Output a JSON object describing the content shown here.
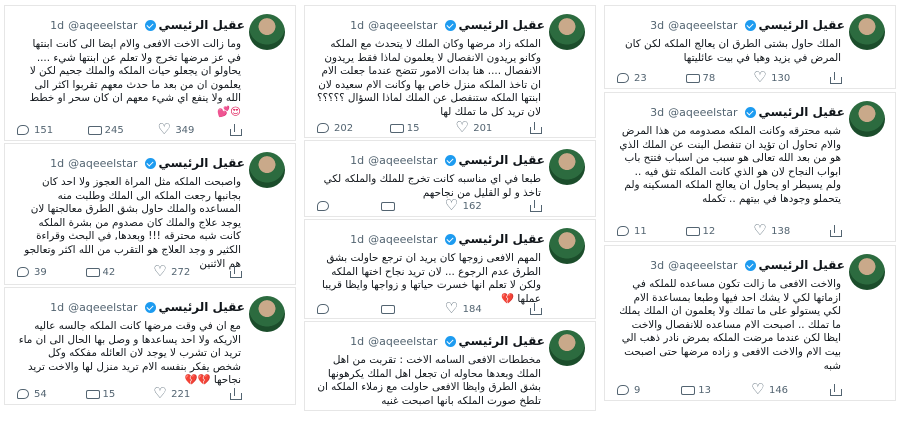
{
  "user": {
    "name": "عقيل الرئيسي",
    "handle": "@aqeeelstar"
  },
  "tweets": [
    {
      "time": "1d",
      "text": "وما زالت الاخت الافعى والام ايضا الى كانت ابنتها في عز مرضها تخرج ولا تعلم عن ابنتها شيء ....\nيحاولو ان يجعلو حيات الملكه والملك جحيم لكن لا يعلمون ان من بعد ما حدث معهم تقربوا اكثر الى الله ولا ينفع اي شيء معهم ان كان سحر او خطط",
      "emoji": "😍💕",
      "replies": "151",
      "retweets": "245",
      "likes": "349"
    },
    {
      "time": "1d",
      "text": "واصبحت الملكه مثل المراة العجوز ولا احد كان بجانبها رجعت الملكه الى الملك وطلبت منه المساعده والملك حاول بشق الطرق معالجتها لان يوجد علاج والملك كان مصدوم من بشرة الملكه كانت شبه محترقه !!! وبعدها, في البحث وقراءة الكثير و وجد العلاج هو التقرب من الله اكثر وتعالجو هم الاثنين",
      "emoji": "",
      "replies": "39",
      "retweets": "42",
      "likes": "272"
    },
    {
      "time": "1d",
      "text": "مع ان في وقت مرضها كانت الملكه جالسه عاليه الاريكه ولا احد يساعدها و وصل بها الحال الى ان ماء تريد ان تشرب لا يوجد لان العائله مفككه وكل شخص يفكر بنفسه الام تريد منزل لها والاخت تريد نجاحها",
      "emoji": "💔💔",
      "replies": "54",
      "retweets": "15",
      "likes": "221"
    },
    {
      "time": "1d",
      "text": "الملكه زاد مرضها وكان الملك لا يتحدث مع الملكه وكانو يريدون الانفصال لا يعلمون لماذا فقط يريدون الانفصال .... هنا بدات الامور تتضح عندما جعلت الام ان تاخذ الملكه منزل خاص بها وكانت الام سعيده لان ابنتها الملكه ستنفصل عن الملك لماذا السؤال ؟؟؟؟؟ لان تريد كل ما تملك لها",
      "emoji": "",
      "replies": "202",
      "retweets": "15",
      "likes": "201"
    },
    {
      "time": "1d",
      "text": "طبعا في اي مناسبه كانت تخرج للملك والملكه لكي تاخذ و لو القليل من نجاحهم",
      "emoji": "",
      "replies": "",
      "retweets": "",
      "likes": "162"
    },
    {
      "time": "1d",
      "text": "المهم الافعى زوجها كان يريد ان ترجع حاولت بشق الطرق عدم الرجوع ... لان تريد نجاح اختها الملكه ولكن لا تعلم انها خسرت حياتها و زواجها وايظا قريبا عملها",
      "emoji": "💔",
      "replies": "",
      "retweets": "",
      "likes": "184"
    },
    {
      "time": "1d",
      "text": "مخططات الافعى السامه الاخت : تقربت من اهل الملك وبعدها محاوله ان تجعل اهل الملك يكرهونها بشق الطرق وايظا الافعى حاولت مع زملاء الملكه ان تلطخ صورت الملكه بانها اصبحت غنيه",
      "emoji": "",
      "replies": "",
      "retweets": "",
      "likes": ""
    },
    {
      "time": "3d",
      "text": "الملك حاول بشتى الطرق ان يعالج الملكه لكن كان المرض في يزيد وهيا في بيت عائليتها",
      "emoji": "",
      "replies": "23",
      "retweets": "78",
      "likes": "130"
    },
    {
      "time": "3d",
      "text": "شبه محترقه وكانت الملكه مصدومه من هذا المرض والام تحاول ان تؤيد ان تنفصل البنت عن الملك الذي هو من بعد الله تعالى هو سبب من اسباب فتتح باب ابواب النجاح لان هو الذي كانت الملكه تثق فيه .. ولم يسيطر او يحاول ان يعالج الملكه المسكينه ولم يتحملو وجودها في بيتهم .. تكمله",
      "emoji": "",
      "replies": "11",
      "retweets": "12",
      "likes": "138"
    },
    {
      "time": "3d",
      "text": "والاخت الافعى ما زالت تكون مساعده للملكه في ازماتها لكي لا يشك احد فيها وطبعا بمساعدة الام لكي يستولو على ما تملك ولا يعلمون ان الملك يملك ما تملك .. اصبحت الام مساعده للانفصال والاخت ايظا لكن عندما مرضت الملكه بمرض نادر ذهب الي بيت الام والاخت الافعى و زاده مرضها حتى اصبحت شبه",
      "emoji": "",
      "replies": "9",
      "retweets": "13",
      "likes": "146"
    }
  ]
}
